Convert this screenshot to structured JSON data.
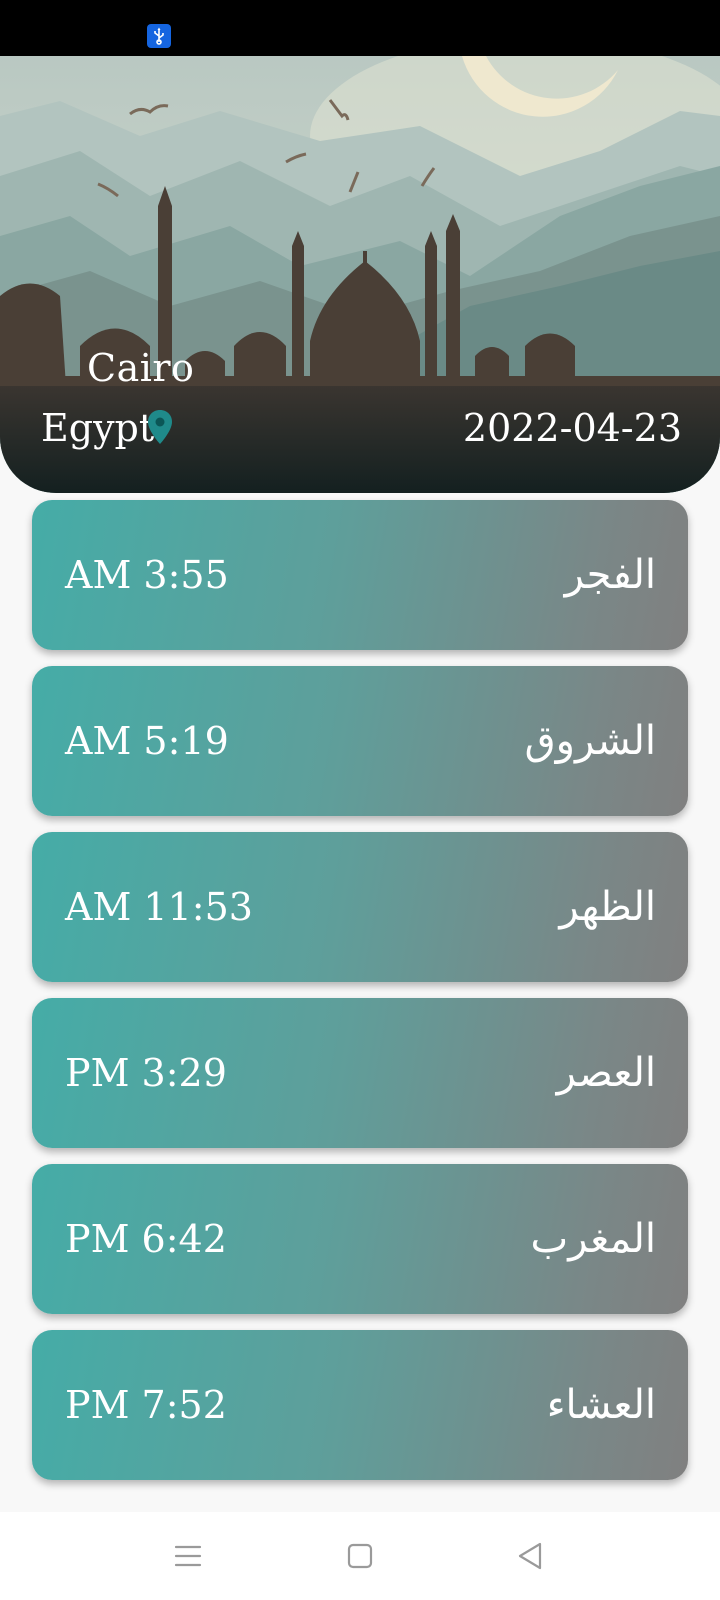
{
  "status_bar": {
    "icons": [
      "usb-icon"
    ]
  },
  "header": {
    "city": "Cairo",
    "country": "Egypt",
    "date": "2022-04-23",
    "icons": [
      "location-pin-icon"
    ],
    "colors": {
      "pin": "#1f8a8a"
    }
  },
  "prayers": [
    {
      "name": "الفجر",
      "time": "AM 3:55"
    },
    {
      "name": "الشروق",
      "time": "AM 5:19"
    },
    {
      "name": "الظهر",
      "time": "AM 11:53"
    },
    {
      "name": "العصر",
      "time": "PM 3:29"
    },
    {
      "name": "المغرب",
      "time": "PM 6:42"
    },
    {
      "name": "العشاء",
      "time": "PM 7:52"
    }
  ],
  "card_gradient": {
    "start": "#45aca7",
    "end": "#808080"
  },
  "nav_bar": {
    "icons": [
      "menu-icon",
      "home-square-icon",
      "back-triangle-icon"
    ]
  }
}
